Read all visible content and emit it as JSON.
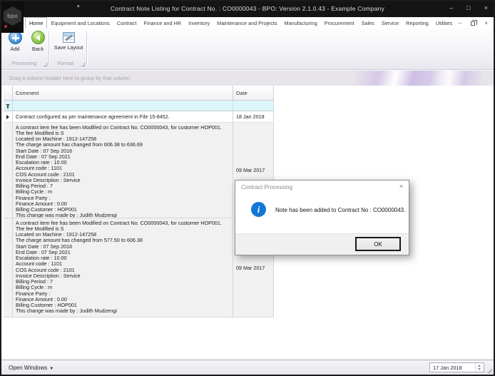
{
  "window": {
    "title": "Contract Note Listing for Contract No. : CO0000043 - BPO: Version 2.1.0.43 - Example Company",
    "logo_text": "bpo",
    "controls": {
      "minimize": "–",
      "maximize": "□",
      "close": "×"
    }
  },
  "ribbon": {
    "tabs": [
      "Home",
      "Equipment and Locations",
      "Contract",
      "Finance and HR",
      "Inventory",
      "Maintenance and Projects",
      "Manufacturing",
      "Procurement",
      "Sales",
      "Service",
      "Reporting",
      "Utilities"
    ],
    "selected_tab": "Home",
    "buttons": {
      "add": "Add",
      "back": "Back",
      "save_layout": "Save Layout"
    },
    "groups": {
      "processing": "Processing",
      "format": "Format"
    },
    "window_controls": {
      "minimize": "–",
      "close": "×"
    }
  },
  "grid": {
    "group_panel_hint": "Drag a column header here to group by that column",
    "columns": {
      "comment": "Comment",
      "date": "Date"
    },
    "rows": [
      {
        "comment": "Contract configured as per maintenance agreement in File 15-8452.",
        "date": "18 Jan 2018"
      },
      {
        "comment": "A contract item fee has been Modified on Contract No. CO0000043, for customer HOP001.\nThe fee Modified is S\nLocated on Machine : 1912-147258\nThe charge amount has changed from 606.38 to 636.69\nStart Date : 07 Sep 2016\nEnd Date : 07 Sep 2021\nEscalation rate : 10.00\nAccount code : 1101\nCOS Account code : 2101\nInvoice Description : Service\nBilling Period : 7\nBilling Cycle : m\nFinance Party :\nFinance Amount : 0.00\nBilling Customer : HOP001\nThis change was made by : Judith Mudzengi",
        "date": "09 Mar 2017"
      },
      {
        "comment": "A contract item fee has been Modified on Contract No. CO0000043, for customer HOP001.\nThe fee Modified is S\nLocated on Machine : 1912-147258\nThe charge amount has changed from 577.50 to 606.38\nStart Date : 07 Sep 2016\nEnd Date : 07 Sep 2021\nEscalation rate : 10.00\nAccount code : 1101\nCOS Account code : 2101\nInvoice Description : Service\nBilling Period : 7\nBilling Cycle : m\nFinance Party :\nFinance Amount : 0.00\nBilling Customer : HOP001\nThis change was made by : Judith Mudzengi",
        "date": "09 Mar 2017"
      }
    ]
  },
  "dialog": {
    "title": "Contract Processing",
    "close_icon": "×",
    "message": "Note has been added to Contract No : CO0000043.",
    "ok_label": "OK"
  },
  "status_bar": {
    "open_windows_label": "Open Windows",
    "date_value": "17 Jan 2018"
  },
  "colors": {
    "title_bar": "#141414",
    "accent_info_blue": "#1377d6",
    "filter_row_cyan": "#dbf5fb",
    "row_gray": "#f1f1f2",
    "swirl_purple": "#baa0e1"
  }
}
